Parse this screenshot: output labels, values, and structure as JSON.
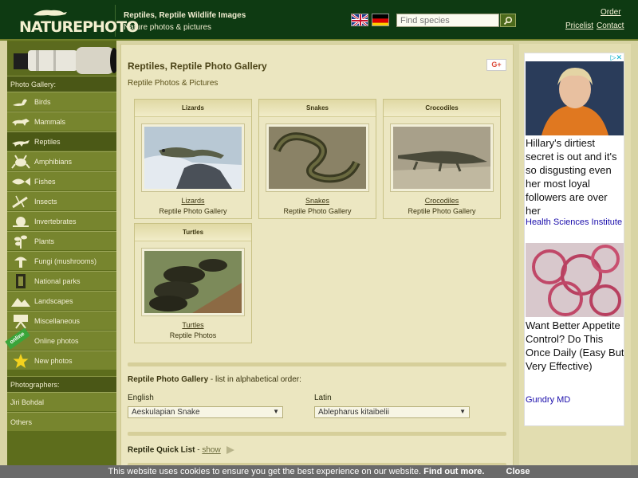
{
  "header": {
    "logo_text": "NATUREPHOTO",
    "site_title": "Reptiles, Reptile Wildlife Images",
    "site_subtitle": "Nature photos & pictures",
    "search_placeholder": "Find species",
    "order": "Order",
    "pricelist": "Pricelist",
    "contact": "Contact"
  },
  "sidebar": {
    "gallery_heading": "Photo Gallery:",
    "items": [
      {
        "label": "Birds",
        "icon": "bird-icon"
      },
      {
        "label": "Mammals",
        "icon": "mammal-icon"
      },
      {
        "label": "Reptiles",
        "icon": "reptile-icon"
      },
      {
        "label": "Amphibians",
        "icon": "frog-icon"
      },
      {
        "label": "Fishes",
        "icon": "fish-icon"
      },
      {
        "label": "Insects",
        "icon": "insect-icon"
      },
      {
        "label": "Invertebrates",
        "icon": "snail-icon"
      },
      {
        "label": "Plants",
        "icon": "plant-icon"
      },
      {
        "label": "Fungi (mushrooms)",
        "icon": "mushroom-icon"
      },
      {
        "label": "National parks",
        "icon": "park-icon"
      },
      {
        "label": "Landscapes",
        "icon": "landscape-icon"
      },
      {
        "label": "Miscellaneous",
        "icon": "camera-icon"
      },
      {
        "label": "Online photos",
        "icon": "online-icon"
      },
      {
        "label": "New photos",
        "icon": "star-icon"
      }
    ],
    "online_badge": "online",
    "photographers_heading": "Photographers:",
    "photographers": [
      "Jiri Bohdal",
      "Others"
    ]
  },
  "main": {
    "title": "Reptiles, Reptile Photo Gallery",
    "subtitle": "Reptile Photos & Pictures",
    "gplus": "G+",
    "cards": [
      {
        "heading": "Lizards",
        "link": "Lizards",
        "sub": "Reptile Photo Gallery"
      },
      {
        "heading": "Snakes",
        "link": "Snakes",
        "sub": "Reptile Photo Gallery"
      },
      {
        "heading": "Crocodiles",
        "link": "Crocodiles",
        "sub": "Reptile Photo Gallery"
      },
      {
        "heading": "Turtles",
        "link": "Turtles",
        "sub": "Reptile Photos"
      }
    ],
    "alpha_title": "Reptile Photo Gallery",
    "alpha_suffix": " - list in alphabetical order:",
    "english_label": "English",
    "english_value": "Aeskulapian Snake",
    "latin_label": "Latin",
    "latin_value": "Ablepharus kitaibelii",
    "quick_list_title": "Reptile Quick List",
    "quick_list_sep": " - ",
    "quick_list_show": "show"
  },
  "ads": {
    "ad1_text": "Hillary's dirtiest secret is out and it's so disgusting even her most loyal followers are over her",
    "ad1_source": "Health Sciences Institute",
    "ad2_text": "Want Better Appetite Control? Do This Once Daily (Easy But Very Effective)",
    "ad2_source": "Gundry MD"
  },
  "cookie": {
    "text": "This website uses cookies to ensure you get the best experience on our website. ",
    "more": "Find out more.",
    "close": "Close"
  }
}
